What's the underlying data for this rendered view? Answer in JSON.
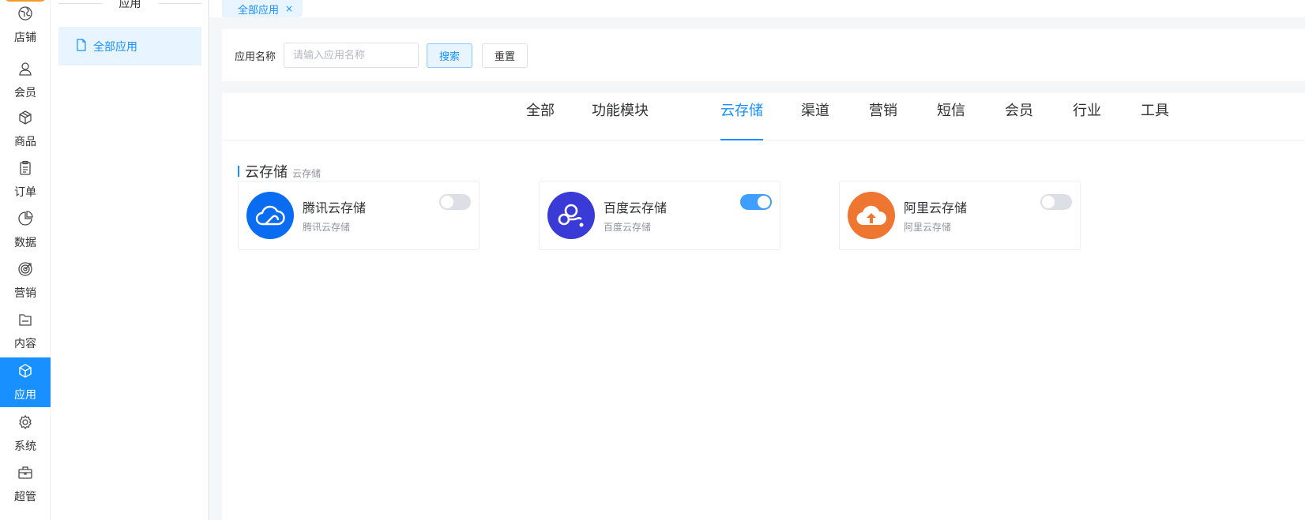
{
  "nav": {
    "items": [
      {
        "label": "店铺",
        "icon": "globe-icon"
      },
      {
        "label": "会员",
        "icon": "user-icon"
      },
      {
        "label": "商品",
        "icon": "box-icon"
      },
      {
        "label": "订单",
        "icon": "clipboard-icon"
      },
      {
        "label": "数据",
        "icon": "pie-chart-icon"
      },
      {
        "label": "营销",
        "icon": "target-icon"
      },
      {
        "label": "内容",
        "icon": "folder-icon"
      },
      {
        "label": "应用",
        "icon": "cube-icon"
      },
      {
        "label": "系统",
        "icon": "gear-icon"
      },
      {
        "label": "超管",
        "icon": "briefcase-icon"
      }
    ],
    "active": "应用"
  },
  "submenu": {
    "title": "应用",
    "items": [
      {
        "label": "全部应用",
        "icon": "file-icon"
      }
    ]
  },
  "tabs": [
    {
      "label": "全部应用",
      "close": "×"
    }
  ],
  "search": {
    "label": "应用名称",
    "placeholder": "请输入应用名称",
    "value": "",
    "search_label": "搜索",
    "reset_label": "重置"
  },
  "categories": {
    "items": [
      "全部",
      "功能模块",
      "云存储",
      "渠道",
      "营销",
      "短信",
      "会员",
      "行业",
      "工具"
    ],
    "active": "云存储"
  },
  "section": {
    "title": "云存储",
    "subtitle": "云存储"
  },
  "apps": [
    {
      "name": "腾讯云存储",
      "desc": "腾讯云存储",
      "enabled": false,
      "color": "#0a6cf0",
      "icon": "tencent-cloud-icon"
    },
    {
      "name": "百度云存储",
      "desc": "百度云存储",
      "enabled": true,
      "color": "#3a3ad6",
      "icon": "baidu-cloud-icon"
    },
    {
      "name": "阿里云存储",
      "desc": "阿里云存储",
      "enabled": false,
      "color": "#ee7631",
      "icon": "aliyun-upload-icon"
    }
  ],
  "colors": {
    "accent": "#1890ff",
    "switch_on": "#409eff",
    "switch_off": "#dcdfe6"
  }
}
